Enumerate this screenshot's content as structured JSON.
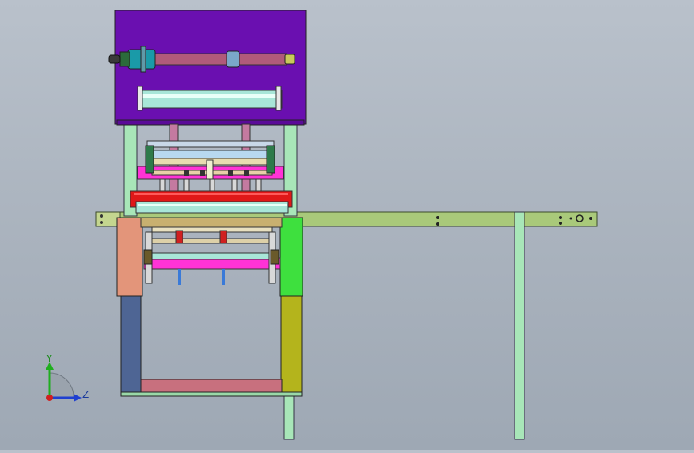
{
  "viewport": {
    "background_top": "#b9c1cb",
    "background_bottom": "#9ea8b4"
  },
  "triad": {
    "y_label": "Y",
    "z_label": "Z",
    "y_color": "#1fae1f",
    "z_color": "#1f3fd0",
    "x_color": "#d01f1f"
  },
  "parts": {
    "top_housing_color": "#6a0fb0",
    "frame_color": "#a8e6b8",
    "rail_color": "#a9c97a",
    "red_plate_color": "#e01818",
    "magenta_bar_color": "#ff33d6",
    "salmon_block_color": "#e3957a",
    "green_block_color": "#3ee03e",
    "blue_leg_color": "#4e6594",
    "olive_leg_color": "#b4b41c",
    "bottom_beam_color": "#c8707e"
  }
}
